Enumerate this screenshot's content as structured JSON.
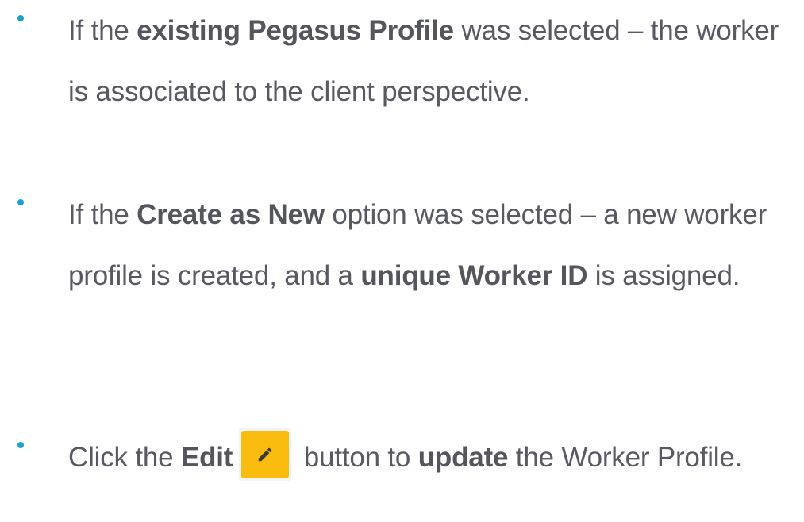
{
  "colors": {
    "bullet": "#1a9fd9",
    "text": "#595963",
    "edit_button": "#f8bb0e",
    "edit_icon": "#3a3a3a"
  },
  "bullets": [
    {
      "p1": "If the ",
      "b1": "existing Pegasus Profile",
      "p2": " was selected – the worker is associated to the client perspective."
    },
    {
      "p1": "If the ",
      "b1": "Create as New",
      "p2": " option was selected – a new worker profile is created, and a ",
      "b2": "unique Worker ID",
      "p3": " is assigned."
    },
    {
      "p1": "Click the ",
      "b1": "Edit",
      "icon": "pencil-icon",
      "p2": " button to ",
      "b2": "update",
      "p3": " the Worker Profile."
    }
  ]
}
